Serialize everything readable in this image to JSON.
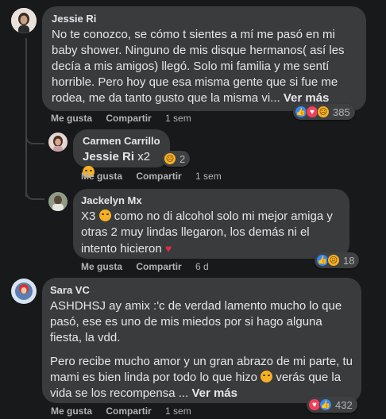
{
  "comments": [
    {
      "author": "Jessie Ri",
      "text": "No te conozco, se cómo t sientes a mí me pasó en mi baby shower. Ninguno de mis disque hermanos( así les decía a mis amigos) llegó. Solo mi familia y me sentí horrible. Pero hoy que esa misma gente que si fue me rodea, me da tanto gusto que la misma vi...",
      "more": "Ver más",
      "like": "Me gusta",
      "reply": "Compartir",
      "time": "1 sem",
      "reactions": [
        "like-icon",
        "love-icon",
        "sad-icon"
      ],
      "reaction_count": "385"
    },
    {
      "author": "Carmen Carrillo",
      "mention": "Jessie Ri",
      "text": "x2",
      "like": "Me gusta",
      "reply": "Compartir",
      "time": "1 sem",
      "reactions": [
        "sad-icon"
      ],
      "reaction_count": "2"
    },
    {
      "author": "Jackelyn Mx",
      "text_parts": [
        "X3",
        "como no di alcohol solo mi mejor amiga y otras 2 muy lindas llegaron, los demás ni el intento hicieron"
      ],
      "like": "Me gusta",
      "reply": "Compartir",
      "time": "6 d",
      "reactions": [
        "like-icon",
        "sad-icon"
      ],
      "reaction_count": "18"
    },
    {
      "author": "Sara VC",
      "paragraph1": "ASHDHSJ ay amix :'c de verdad lamento mucho lo que pasó, ese es uno de mis miedos por si hago alguna fiesta, la vdd.",
      "paragraph2_parts": [
        "Pero recibe mucho amor y un gran abrazo de mi parte, tu mami es bien linda por todo lo que hizo",
        "verás que la vida se los recompensa ..."
      ],
      "more": "Ver más",
      "like": "Me gusta",
      "reply": "Compartir",
      "time": "1 sem",
      "reactions": [
        "love-icon",
        "like-icon"
      ],
      "reaction_count": "432"
    }
  ],
  "colors": {
    "background": "#18191a",
    "bubble": "#3a3b3c",
    "text": "#e4e6eb",
    "secondary": "#b0b3b8",
    "like": "#2d88ff",
    "love": "#f33e58",
    "sad": "#f7b125"
  }
}
